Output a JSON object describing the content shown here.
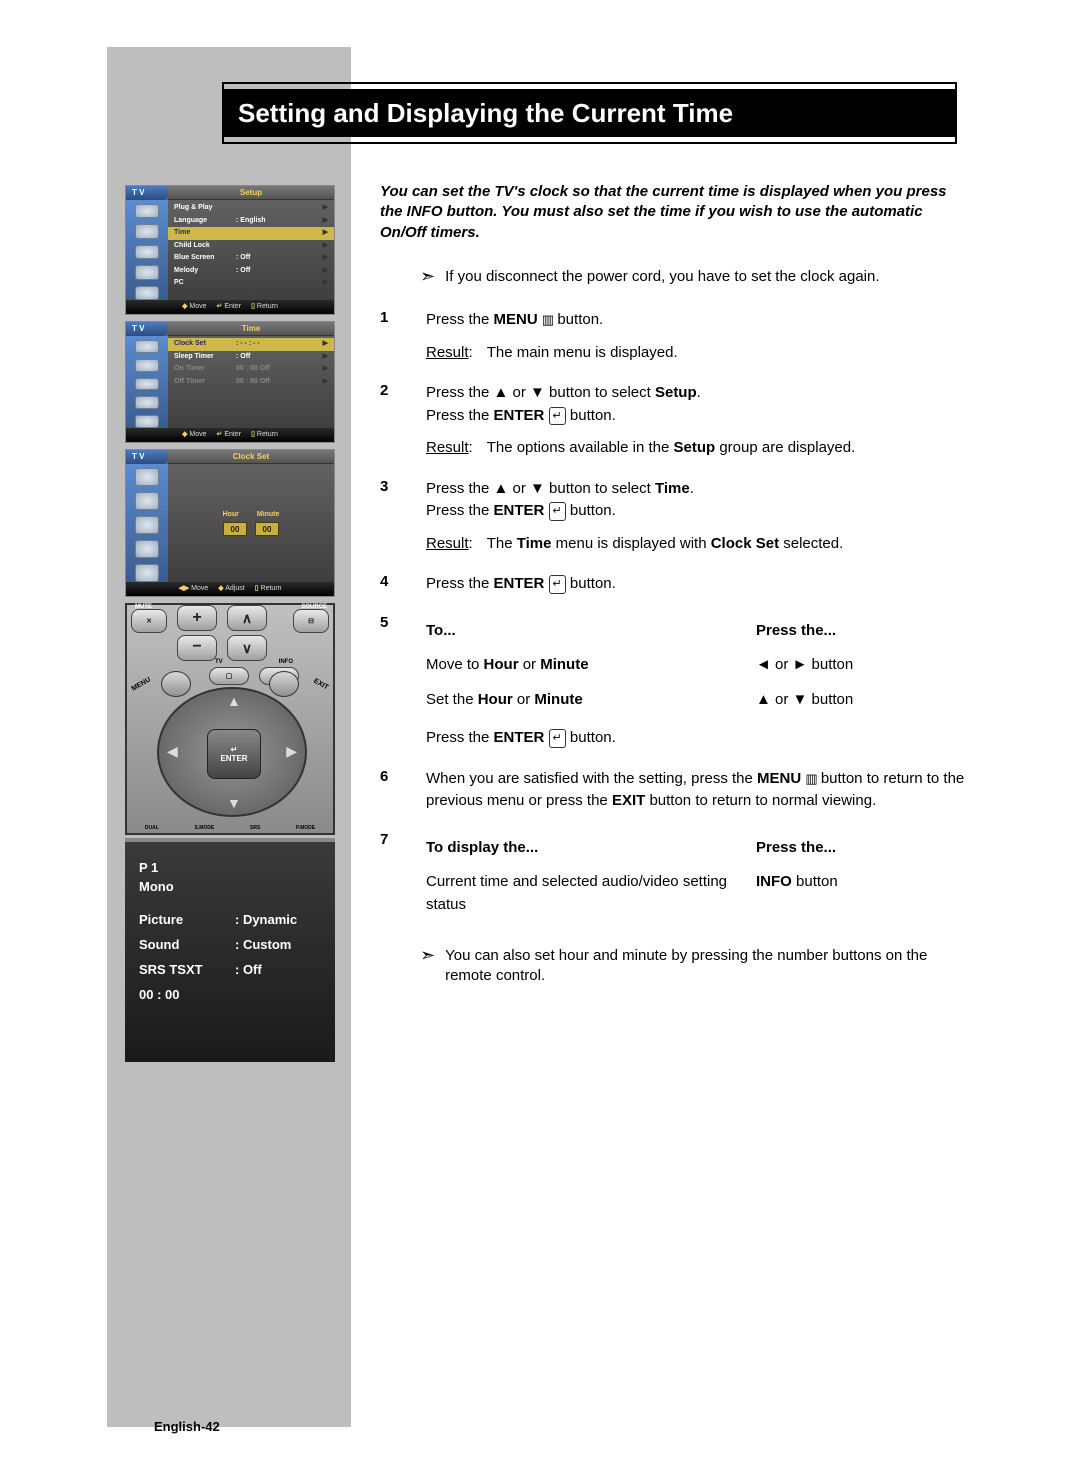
{
  "title": "Setting and Displaying the Current Time",
  "intro": "You can set the TV's clock so that the current time is displayed when you press the INFO button. You must also set the time if you wish to use the automatic On/Off timers.",
  "note1": "If you disconnect the power cord, you have to set the clock again.",
  "steps": {
    "s1": {
      "num": "1",
      "line": "Press the MENU button.",
      "result_label": "Result",
      "result": "The main menu is displayed."
    },
    "s2": {
      "num": "2",
      "line1a": "Press the ▲ or ▼ button to select ",
      "line1b": "Setup",
      "line1c": ".",
      "line2": "Press the ENTER button.",
      "result_label": "Result",
      "result_a": "The options available in the ",
      "result_b": "Setup",
      "result_c": " group are displayed."
    },
    "s3": {
      "num": "3",
      "line1a": "Press the ▲ or ▼ button to select ",
      "line1b": "Time",
      "line1c": ".",
      "line2": "Press the ENTER button.",
      "result_label": "Result",
      "result_a": "The ",
      "result_b": "Time",
      "result_c": " menu is displayed with ",
      "result_d": "Clock Set",
      "result_e": " selected."
    },
    "s4": {
      "num": "4",
      "line": "Press the ENTER button."
    },
    "s5": {
      "num": "5",
      "hdr_left": "To...",
      "hdr_right": "Press the...",
      "r1l_a": "Move to ",
      "r1l_b": "Hour",
      "r1l_c": " or ",
      "r1l_d": "Minute",
      "r1r": "◄ or ► button",
      "r2l_a": "Set the ",
      "r2l_b": "Hour",
      "r2l_c": " or ",
      "r2l_d": "Minute",
      "r2r": "▲ or ▼ button",
      "r3": "Press the ENTER button."
    },
    "s6": {
      "num": "6",
      "text_a": "When you are satisfied with the setting, press the ",
      "text_b": "MENU",
      "text_c": " button to return to the previous menu or press the ",
      "text_d": "EXIT",
      "text_e": " button to return to normal viewing."
    },
    "s7": {
      "num": "7",
      "hdr_left": "To display the...",
      "hdr_right": "Press the...",
      "r1l": "Current time and selected audio/video setting status",
      "r1r_a": "INFO",
      "r1r_b": " button"
    }
  },
  "note2": "You can also set hour and minute by pressing the number buttons on the remote control.",
  "footer": "English-42",
  "osd1": {
    "tv": "T V",
    "title": "Setup",
    "rows": [
      {
        "k": "Plug & Play",
        "v": "",
        "ar": "▶"
      },
      {
        "k": "Language",
        "v": ": English",
        "ar": "▶"
      },
      {
        "k": "Time",
        "v": "",
        "ar": "▶",
        "hi": true
      },
      {
        "k": "Child Lock",
        "v": "",
        "ar": "▶"
      },
      {
        "k": "Blue Screen",
        "v": ": Off",
        "ar": "▶"
      },
      {
        "k": "Melody",
        "v": ": Off",
        "ar": "▶"
      },
      {
        "k": "PC",
        "v": "",
        "ar": "▶"
      }
    ],
    "foot": [
      "Move",
      "Enter",
      "Return"
    ]
  },
  "osd2": {
    "tv": "T V",
    "title": "Time",
    "rows": [
      {
        "k": "Clock Set",
        "v": ":       - - : - -",
        "ar": "▶",
        "hi": true
      },
      {
        "k": "Sleep Timer",
        "v": ":       Off",
        "ar": "▶"
      },
      {
        "k": "On Timer",
        "v": "   00 : 00      Off",
        "ar": "▶",
        "dim": true
      },
      {
        "k": "Off Timer",
        "v": "   00 : 00      Off",
        "ar": "▶",
        "dim": true
      }
    ],
    "foot": [
      "Move",
      "Enter",
      "Return"
    ]
  },
  "osd3": {
    "tv": "T V",
    "title": "Clock Set",
    "hour_lbl": "Hour",
    "minute_lbl": "Minute",
    "hour_val": "00",
    "minute_val": "00",
    "foot": [
      "Move",
      "Adjust",
      "Return"
    ]
  },
  "remote": {
    "mute": "MUTE",
    "source": "SOURCE",
    "tv": "TV",
    "info": "INFO",
    "menu": "MENU",
    "exit": "EXIT",
    "enter": "ENTER",
    "mute_icon": "✕",
    "src_icon": "⊟",
    "bottom": [
      "DUAL",
      "S.MODE",
      "SRS",
      "P.MODE"
    ]
  },
  "info": {
    "p": "P    1",
    "mono": "Mono",
    "rows": [
      {
        "k": "Picture",
        "v": ": Dynamic"
      },
      {
        "k": "Sound",
        "v": ": Custom"
      },
      {
        "k": "SRS TSXT",
        "v": ": Off"
      }
    ],
    "time": "00 : 00"
  }
}
